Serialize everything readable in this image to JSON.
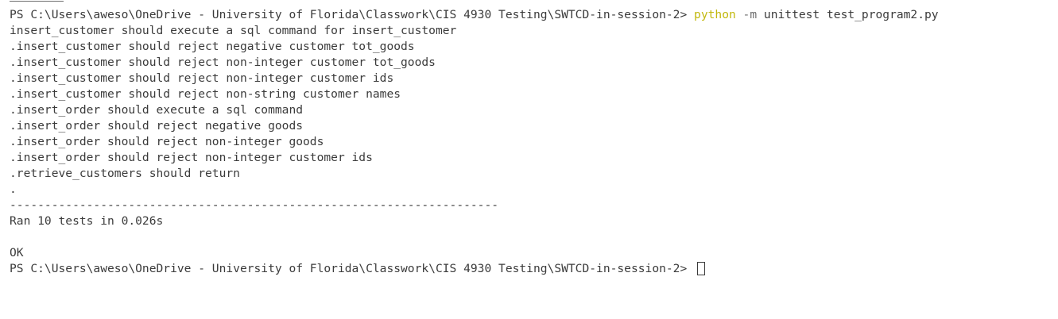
{
  "terminal": {
    "prompt1": {
      "path": "PS C:\\Users\\aweso\\OneDrive - University of Florida\\Classwork\\CIS 4930 Testing\\SWTCD-in-session-2> ",
      "command": "python",
      "flag": " -m ",
      "args": "unittest test_program2.py"
    },
    "output": [
      "insert_customer should execute a sql command for insert_customer",
      ".insert_customer should reject negative customer tot_goods",
      ".insert_customer should reject non-integer customer tot_goods",
      ".insert_customer should reject non-integer customer ids",
      ".insert_customer should reject non-string customer names",
      ".insert_order should execute a sql command",
      ".insert_order should reject negative goods",
      ".insert_order should reject non-integer goods",
      ".insert_order should reject non-integer customer ids",
      ".retrieve_customers should return",
      ".",
      "----------------------------------------------------------------------",
      "Ran 10 tests in 0.026s",
      "",
      "OK"
    ],
    "prompt2": {
      "path": "PS C:\\Users\\aweso\\OneDrive - University of Florida\\Classwork\\CIS 4930 Testing\\SWTCD-in-session-2> "
    }
  },
  "colors": {
    "background": "#ffffff",
    "text": "#3b3b3b",
    "command": "#c2b80e",
    "flag": "#6e6e6e"
  }
}
